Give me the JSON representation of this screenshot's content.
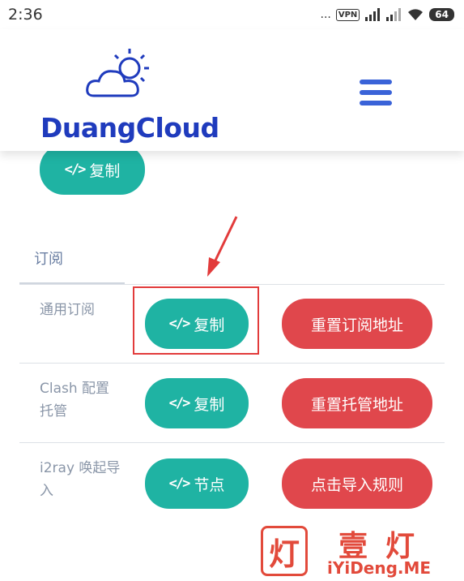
{
  "status_bar": {
    "time": "2:36",
    "dots": "...",
    "vpn": "VPN",
    "battery": "64"
  },
  "header": {
    "logo_text": "DuangCloud",
    "menu_icon": "hamburger-menu-icon"
  },
  "top_button": {
    "icon": "</>",
    "label": "复制"
  },
  "section": {
    "title": "订阅"
  },
  "rows": [
    {
      "label": "通用订阅",
      "copy_icon": "</>",
      "copy_label": "复制",
      "reset_label": "重置订阅地址"
    },
    {
      "label": "Clash 配置托管",
      "copy_icon": "</>",
      "copy_label": "复制",
      "reset_label": "重置托管地址"
    },
    {
      "label": "i2ray 唤起导入",
      "copy_icon": "</>",
      "copy_label": "节点",
      "reset_label": "点击导入规则"
    }
  ],
  "watermark": {
    "badge": "灯",
    "title": "壹灯",
    "url": "iYiDeng.ME"
  },
  "colors": {
    "teal": "#1fb3a3",
    "red": "#e0474c",
    "brand_blue": "#1f3bbd",
    "menu_blue": "#3a63d8",
    "highlight": "#e23b3b"
  }
}
